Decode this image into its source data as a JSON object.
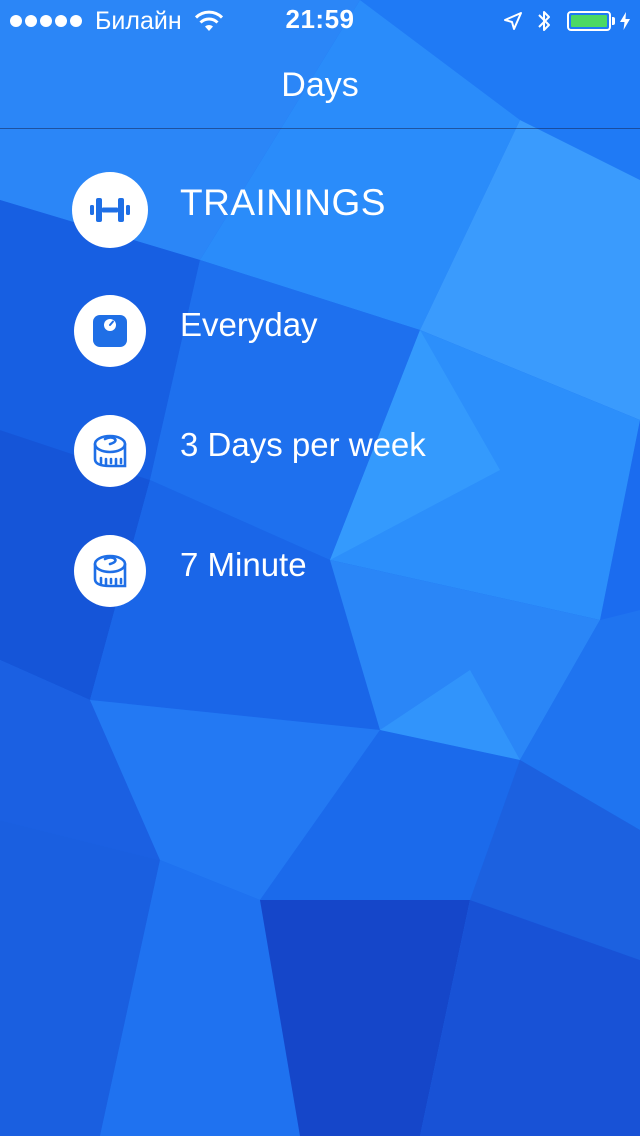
{
  "status_bar": {
    "carrier": "Билайн",
    "time": "21:59"
  },
  "nav": {
    "title": "Days"
  },
  "menu": [
    {
      "label": "TRAININGS",
      "icon": "dumbbell-icon"
    },
    {
      "label": "Everyday",
      "icon": "scale-icon"
    },
    {
      "label": "3 Days per week",
      "icon": "measuring-tape-icon"
    },
    {
      "label": "7 Minute",
      "icon": "measuring-tape-icon"
    }
  ],
  "colors": {
    "background": "#1a6ef0",
    "icon_blue": "#1f6fe6",
    "battery_green": "#4cd964"
  }
}
